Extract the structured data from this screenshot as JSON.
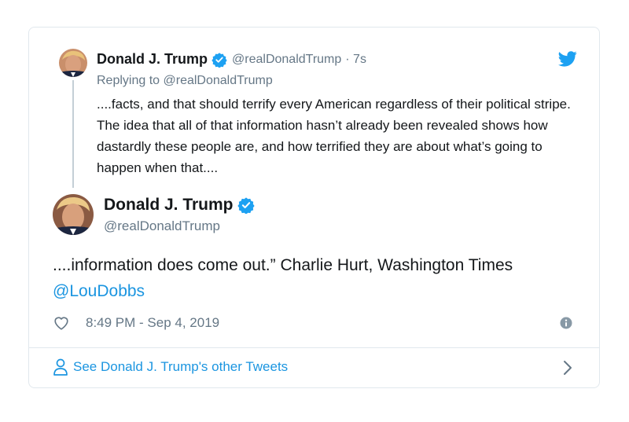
{
  "parent_tweet": {
    "author_name": "Donald J. Trump",
    "handle": "@realDonaldTrump",
    "time_ago": "· 7s",
    "reply_prefix": "Replying to",
    "reply_to": "@realDonaldTrump",
    "text": "....facts, and that should terrify every American regardless of their political stripe. The idea that all of that information hasn’t already been revealed shows how dastardly these people are, and how terrified they are about what’s going to happen when that...."
  },
  "main_tweet": {
    "author_name": "Donald J. Trump",
    "handle": "@realDonaldTrump",
    "text": "....information does come out.” Charlie Hurt, Washington Times",
    "mention": "@LouDobbs",
    "timestamp": "8:49 PM - Sep 4, 2019"
  },
  "footer": {
    "link_label": "See Donald J. Trump's other Tweets"
  },
  "colors": {
    "twitter_blue": "#1da1f2",
    "link_blue": "#1b95e0",
    "secondary_text": "#657786",
    "border": "#e1e8ed"
  }
}
